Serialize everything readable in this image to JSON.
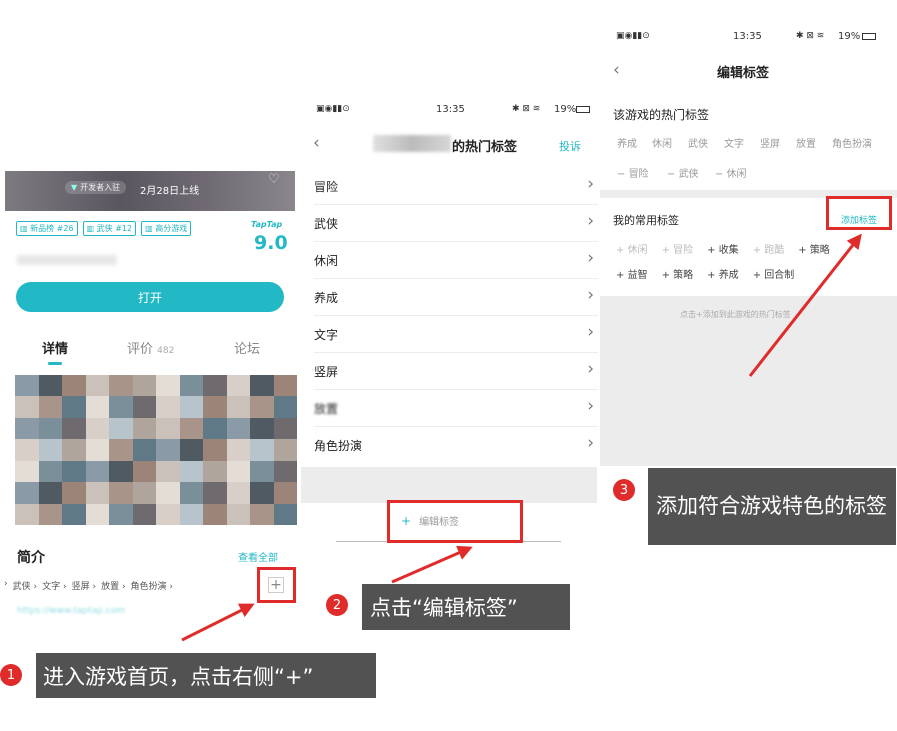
{
  "colors": {
    "accent": "#22b8c5",
    "red": "#e02b2b",
    "callout_bg": "#525252"
  },
  "panel1": {
    "header": {
      "badge": "开发者入驻",
      "date": "2月28日上线"
    },
    "tags": [
      "新品榜 #26",
      "武侠 #12",
      "高分游戏"
    ],
    "rating": {
      "brand": "TapTap",
      "score": "9.0"
    },
    "open_button": "打开",
    "tabs": [
      {
        "label": "详情"
      },
      {
        "label": "评价",
        "count": "482"
      },
      {
        "label": "论坛"
      }
    ],
    "intro": {
      "title": "简介",
      "see_all": "查看全部"
    },
    "tag_row": [
      "武侠",
      "文字",
      "竖屏",
      "放置",
      "角色扮演"
    ],
    "add_label": "+",
    "url_text": "https://www.taptap.com"
  },
  "panel2": {
    "status": {
      "time": "13:35",
      "battery": "19%"
    },
    "title_suffix": "的热门标签",
    "report": "投诉",
    "items": [
      "冒险",
      "武侠",
      "休闲",
      "养成",
      "文字",
      "竖屏",
      "放置",
      "角色扮演"
    ],
    "edit_button": "编辑标签"
  },
  "panel3": {
    "status": {
      "time": "13:35",
      "battery": "19%"
    },
    "title": "编辑标签",
    "hot_title": "该游戏的热门标签",
    "hot_row1": [
      "养成",
      "休闲",
      "武侠",
      "文字",
      "竖屏",
      "放置",
      "角色扮演"
    ],
    "hot_row2": [
      "冒险",
      "武侠",
      "休闲"
    ],
    "mine_title": "我的常用标签",
    "add_tag": "添加标签",
    "mine_row1": [
      {
        "t": "休闲",
        "on": false
      },
      {
        "t": "冒险",
        "on": false
      },
      {
        "t": "收集",
        "on": true
      },
      {
        "t": "跑酷",
        "on": false
      },
      {
        "t": "策略",
        "on": true
      }
    ],
    "mine_row2": [
      {
        "t": "益智",
        "on": true
      },
      {
        "t": "策略",
        "on": true
      },
      {
        "t": "养成",
        "on": true
      },
      {
        "t": "回合制",
        "on": true
      }
    ],
    "empty_hint": "点击+添加到此游戏的热门标签"
  },
  "callouts": [
    {
      "num": "1",
      "text": "进入游戏首页，点击右侧“+”"
    },
    {
      "num": "2",
      "text": "点击“编辑标签”"
    },
    {
      "num": "3",
      "text": "添加符合游戏特色的标签"
    }
  ]
}
